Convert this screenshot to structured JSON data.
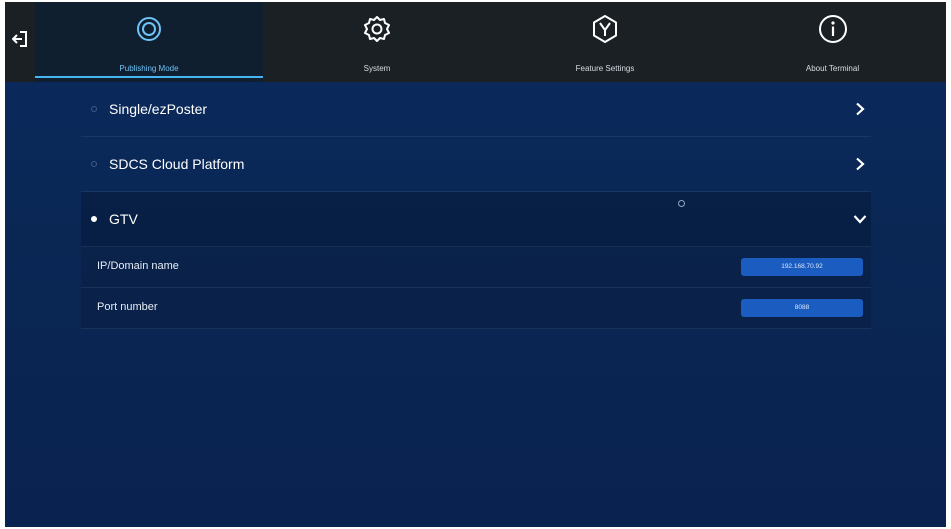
{
  "nav": {
    "exit_icon": "exit-icon",
    "tabs": [
      {
        "label": "Publishing Mode",
        "icon": "publishing-mode-icon",
        "active": true
      },
      {
        "label": "System",
        "icon": "gear-icon",
        "active": false
      },
      {
        "label": "Feature Settings",
        "icon": "feature-settings-icon",
        "active": false
      },
      {
        "label": "About Terminal",
        "icon": "info-icon",
        "active": false
      }
    ]
  },
  "modes": [
    {
      "label": "Single/ezPoster",
      "selected": false,
      "expanded": false
    },
    {
      "label": "SDCS Cloud Platform",
      "selected": false,
      "expanded": false
    },
    {
      "label": "GTV",
      "selected": true,
      "expanded": true
    }
  ],
  "gtv_settings": {
    "ip_label": "IP/Domain name",
    "ip_value": "192.168.70.92",
    "port_label": "Port number",
    "port_value": "8088"
  },
  "colors": {
    "background": "#0a2754",
    "topbar": "#1b2025",
    "accent": "#48b4f0",
    "input": "#1a5cc0"
  }
}
